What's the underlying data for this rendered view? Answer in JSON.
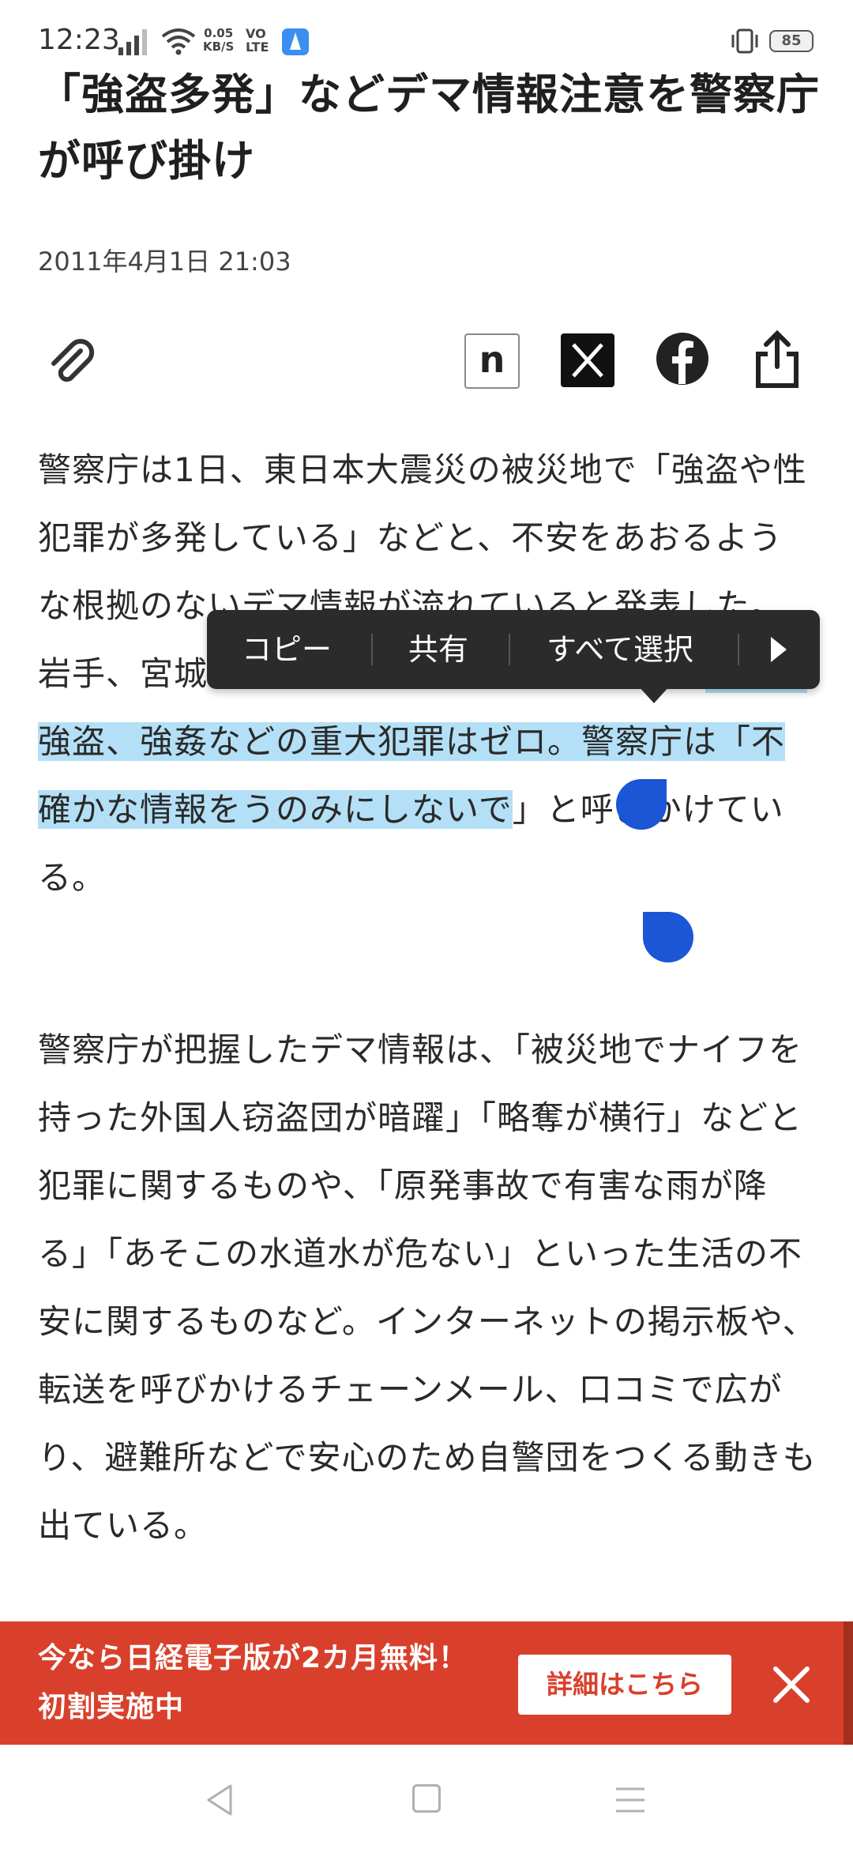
{
  "status_bar": {
    "time": "12:23",
    "net_speed_value": "0.05",
    "net_speed_unit": "KB/S",
    "volte_1": "VO",
    "volte_2": "LTE",
    "battery": "85"
  },
  "article": {
    "title": "「強盗多発」などデマ情報注意を警察庁が呼び掛け",
    "date": "2011年4月1日 21:03",
    "p1_before": "警察庁は1日、東日本大震災の被災地で「強盗や性犯罪が多発している」などと、不安をあおるような根拠のないデマ情報が流れていると発表した。岩手、宮城、福島3県の被災地で確認された",
    "p1_selected": "殺人や強盗、強姦などの重大犯罪はゼロ。警察庁は「不確かな情報をうのみにしないで",
    "p1_after": "」と呼びかけている。",
    "p2": "警察庁が把握したデマ情報は、「被災地でナイフを持った外国人窃盗団が暗躍」「略奪が横行」などと犯罪に関するものや、「原発事故で有害な雨が降る」「あそこの水道水が危ない」といった生活の不安に関するものなど。インターネットの掲示板や、転送を呼びかけるチェーンメール、口コミで広がり、避難所などで安心のため自警団をつくる動きも出ている。"
  },
  "share": {
    "note_label": "n",
    "icons": [
      "paperclip-icon",
      "note-icon",
      "x-icon",
      "facebook-icon",
      "share-icon"
    ]
  },
  "context_menu": {
    "copy": "コピー",
    "share": "共有",
    "select_all": "すべて選択"
  },
  "promo": {
    "text": "今なら日経電子版が2カ月無料！初割実施中",
    "button": "詳細はこちら"
  },
  "colors": {
    "promo_bg": "#d9402b",
    "selection": "#b4e0f7",
    "handle": "#1a56d6"
  }
}
